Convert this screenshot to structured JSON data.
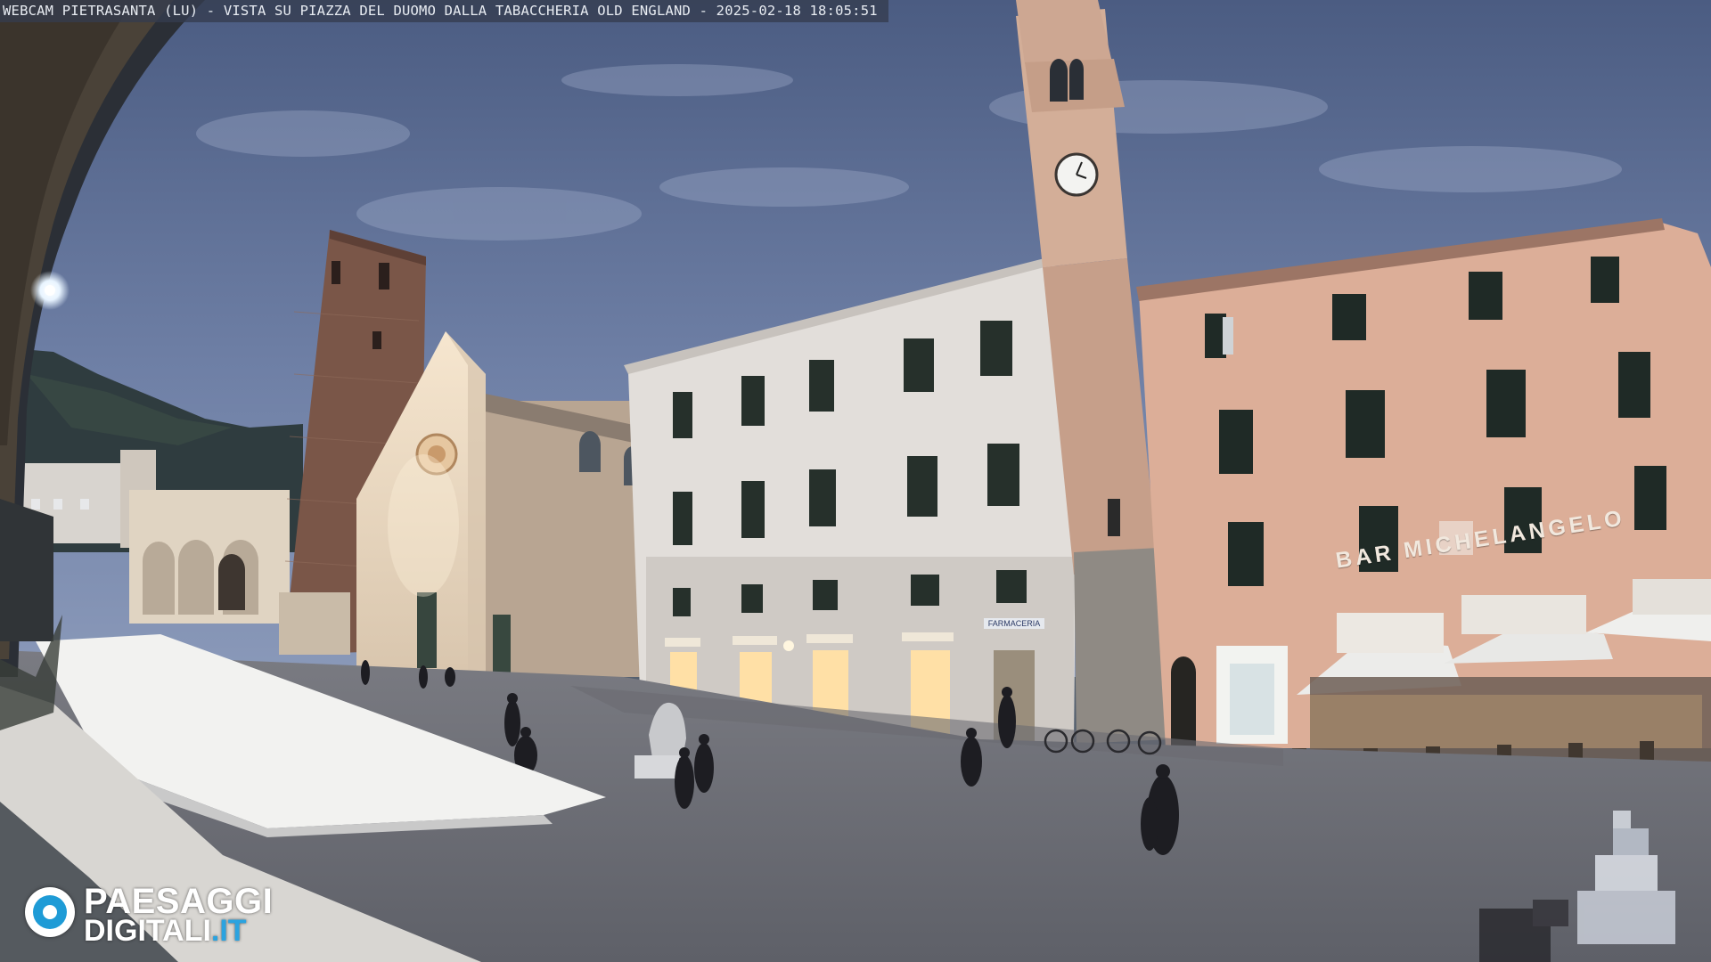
{
  "caption": {
    "text": "WEBCAM PIETRASANTA (LU) - VISTA SU PIAZZA DEL DUOMO DALLA TABACCHERIA OLD ENGLAND - 2025-02-18 18:05:51"
  },
  "logo": {
    "line1": "PAESAGGI",
    "line2_main": "DIGITALI",
    "line2_tld": ".IT",
    "icon": "lens-icon"
  },
  "signs": {
    "bar": "BAR MICHELANGELO",
    "shop": "FARMACERIA"
  },
  "palette": {
    "sky_top": "#4e5f85",
    "sky_bottom": "#8898bb",
    "white_building": "#e4e0dc",
    "pink_building": "#e1b19b",
    "tower_stone": "#cfa893",
    "brick_tower": "#7a5648",
    "marble": "#e8dccb",
    "piazza": "#6f717a",
    "window_lit": "#ffe4b0",
    "logo_blue": "#1e9bd6"
  }
}
